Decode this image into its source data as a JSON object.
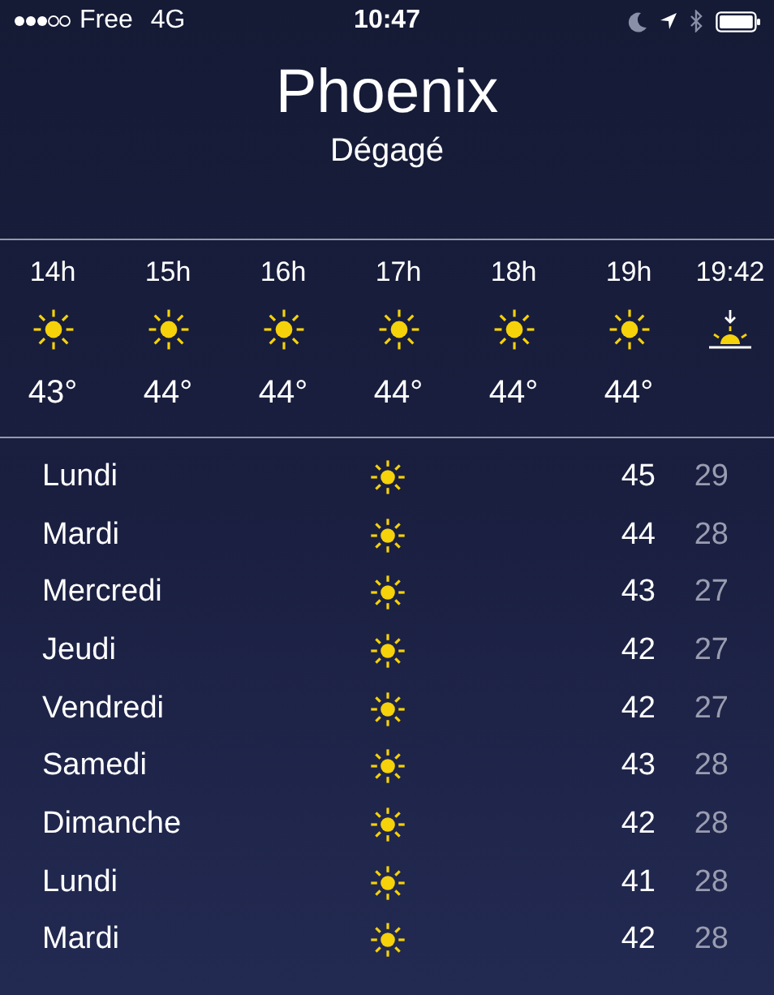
{
  "status_bar": {
    "carrier": "Free",
    "network": "4G",
    "time": "10:47"
  },
  "location": {
    "city": "Phoenix",
    "condition": "Dégagé"
  },
  "hourly": [
    {
      "time": "14h",
      "kind": "sun",
      "temp": "43°"
    },
    {
      "time": "15h",
      "kind": "sun",
      "temp": "44°"
    },
    {
      "time": "16h",
      "kind": "sun",
      "temp": "44°"
    },
    {
      "time": "17h",
      "kind": "sun",
      "temp": "44°"
    },
    {
      "time": "18h",
      "kind": "sun",
      "temp": "44°"
    },
    {
      "time": "19h",
      "kind": "sun",
      "temp": "44°"
    },
    {
      "time": "19:42",
      "kind": "sunset"
    }
  ],
  "daily": [
    {
      "day": "Lundi",
      "kind": "sun",
      "high": "45",
      "low": "29"
    },
    {
      "day": "Mardi",
      "kind": "sun",
      "high": "44",
      "low": "28"
    },
    {
      "day": "Mercredi",
      "kind": "sun",
      "high": "43",
      "low": "27"
    },
    {
      "day": "Jeudi",
      "kind": "sun",
      "high": "42",
      "low": "27"
    },
    {
      "day": "Vendredi",
      "kind": "sun",
      "high": "42",
      "low": "27"
    },
    {
      "day": "Samedi",
      "kind": "sun",
      "high": "43",
      "low": "28"
    },
    {
      "day": "Dimanche",
      "kind": "sun",
      "high": "42",
      "low": "28"
    },
    {
      "day": "Lundi",
      "kind": "sun",
      "high": "41",
      "low": "28"
    },
    {
      "day": "Mardi",
      "kind": "sun",
      "high": "42",
      "low": "28"
    }
  ]
}
